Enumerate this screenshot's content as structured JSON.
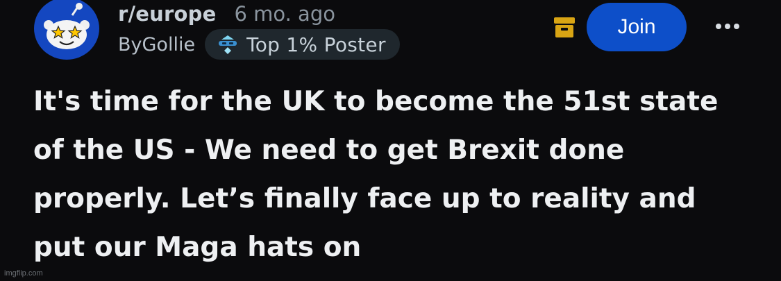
{
  "community": {
    "name": "r/europe",
    "age": "6 mo. ago",
    "icon": "reddit-snoo-star-eyes-icon"
  },
  "author": {
    "byline": "ByGollie",
    "flair_label": "Top 1% Poster",
    "flair_icon": "top-poster-badge-icon"
  },
  "actions": {
    "archive_icon": "archive-box-icon",
    "join_label": "Join",
    "more_icon": "more-options-icon"
  },
  "post": {
    "title": "It's time for the UK to become the 51st state of the US - We need to get Brexit done properly. Let’s finally face up to reality and put our Maga hats on"
  },
  "watermark": "imgflip.com",
  "colors": {
    "background": "#0b0b0d",
    "join_button": "#0d4fc9",
    "archive_icon": "#d9a514",
    "avatar_blue": "#1447c0",
    "star_yellow": "#ffc700"
  }
}
